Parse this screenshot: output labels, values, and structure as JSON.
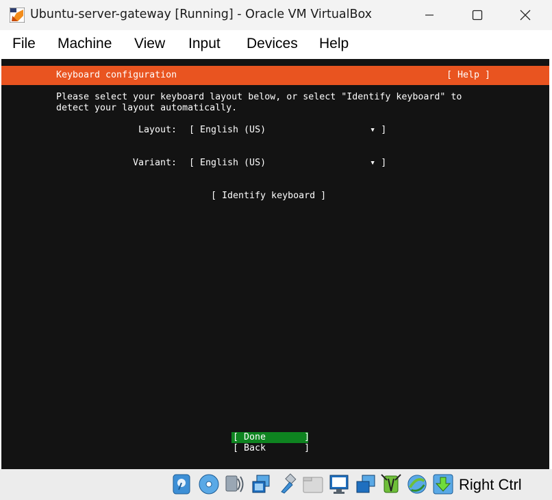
{
  "window": {
    "title": "Ubuntu-server-gateway [Running] - Oracle VM VirtualBox"
  },
  "menu": {
    "items": [
      "File",
      "Machine",
      "View",
      "Input",
      "Devices",
      "Help"
    ]
  },
  "installer": {
    "header_title": "Keyboard configuration",
    "help_label": "[ Help ]",
    "instructions_line1": "Please select your keyboard layout below, or select \"Identify keyboard\" to",
    "instructions_line2": "detect your layout automatically.",
    "layout_label": "Layout:",
    "layout_value": "[ English (US)                   ▾ ]",
    "variant_label": "Variant:",
    "variant_value": "[ English (US)                   ▾ ]",
    "identify_button": "[ Identify keyboard ]",
    "done_button": "[ Done       ]",
    "back_button": "[ Back       ]"
  },
  "statusbar": {
    "icons": [
      "hard-disk-icon",
      "optical-drive-icon",
      "audio-icon",
      "network-icon",
      "usb-icon",
      "shared-folders-icon",
      "display-icon",
      "recording-icon",
      "mouse-integration-icon",
      "virtualization-icon",
      "arrow-down-icon"
    ],
    "host_key": "Right Ctrl"
  },
  "colors": {
    "header_orange": "#e95420",
    "done_green": "#0e8420",
    "terminal_bg": "#131313"
  }
}
